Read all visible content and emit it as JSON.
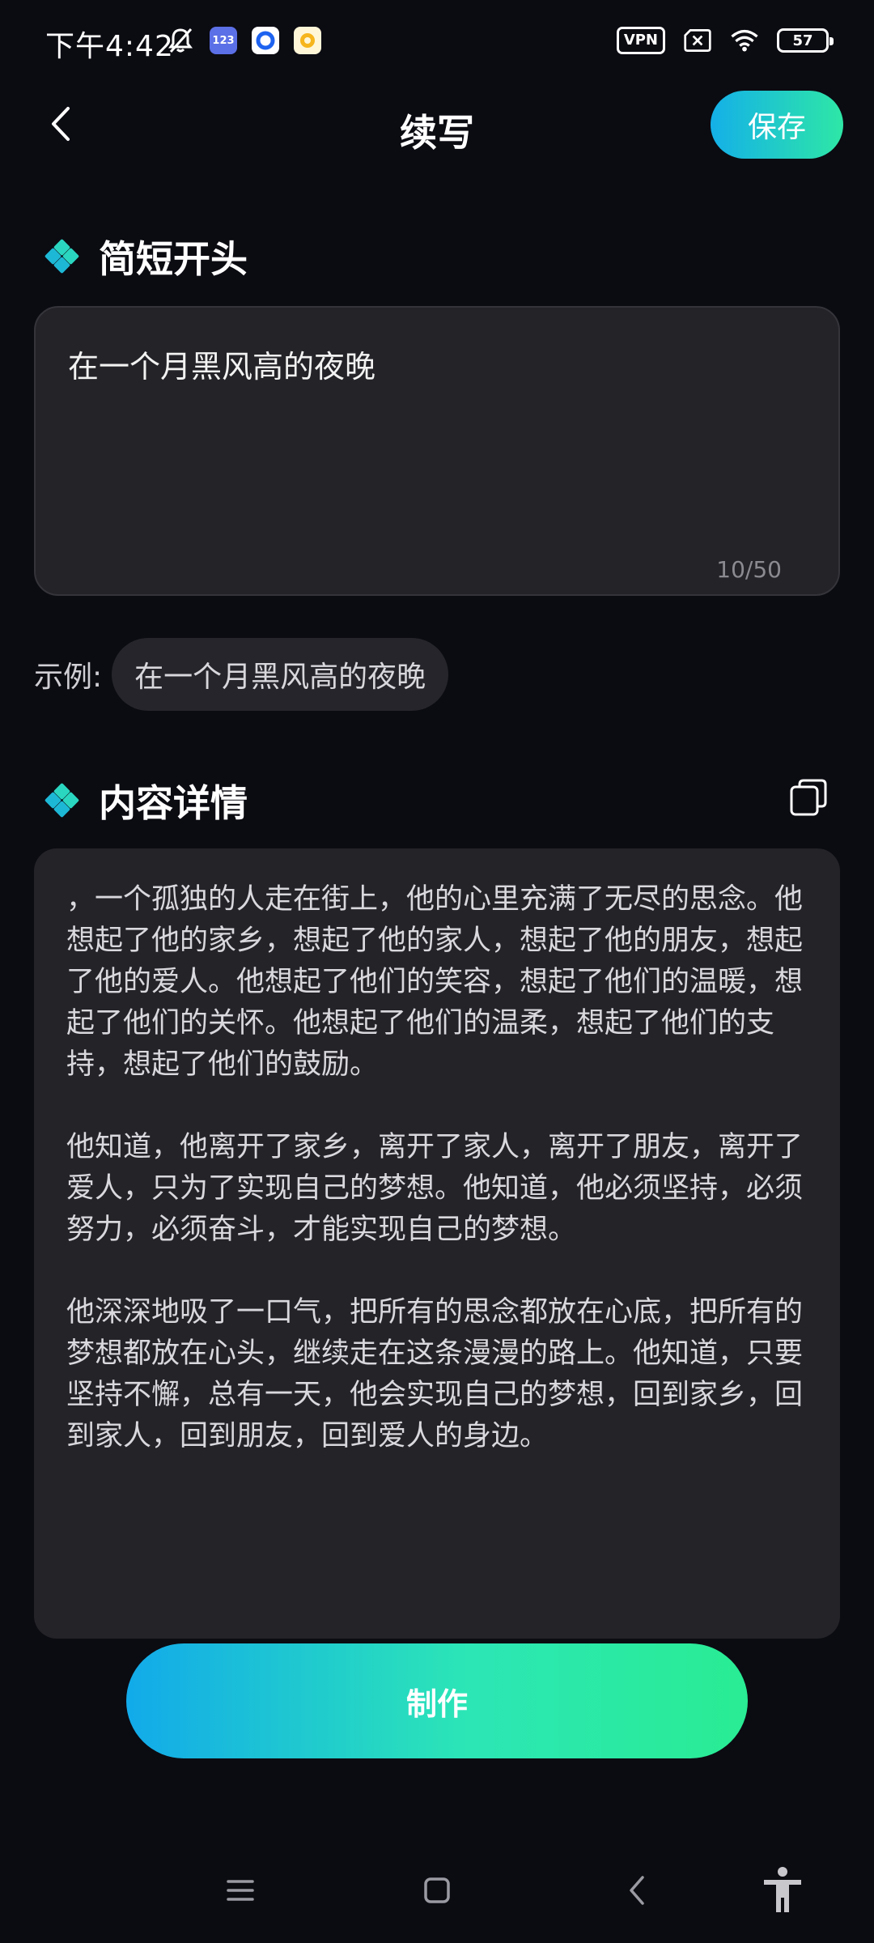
{
  "status_bar": {
    "time": "下午4:42",
    "app_badge_1": "123",
    "vpn_label": "VPN",
    "battery_level": "57"
  },
  "header": {
    "title": "续写",
    "save_label": "保存"
  },
  "opening_section": {
    "heading": "简短开头",
    "input_value": "在一个月黑风高的夜晚",
    "char_count": "10/50"
  },
  "example": {
    "label": "示例:",
    "chip_text": "在一个月黑风高的夜晚"
  },
  "content_section": {
    "heading": "内容详情",
    "paragraphs": [
      "，一个孤独的人走在街上，他的心里充满了无尽的思念。他想起了他的家乡，想起了他的家人，想起了他的朋友，想起了他的爱人。他想起了他们的笑容，想起了他们的温暖，想起了他们的关怀。他想起了他们的温柔，想起了他们的支持，想起了他们的鼓励。",
      "他知道，他离开了家乡，离开了家人，离开了朋友，离开了爱人，只为了实现自己的梦想。他知道，他必须坚持，必须努力，必须奋斗，才能实现自己的梦想。",
      "他深深地吸了一口气，把所有的思念都放在心底，把所有的梦想都放在心头，继续走在这条漫漫的路上。他知道，只要坚持不懈，总有一天，他会实现自己的梦想，回到家乡，回到家人，回到朋友，回到爱人的身边。"
    ]
  },
  "action": {
    "make_label": "制作"
  },
  "colors": {
    "background": "#0b0b12",
    "card": "#232328",
    "accent_start": "#12aaea",
    "accent_end": "#29ec93",
    "diamond_teal": "#2ad6c0"
  },
  "icons": {
    "back": "chevron-left-icon",
    "section_marker": "diamond-cluster-icon",
    "copy": "copy-icon",
    "nav_menu": "menu-icon",
    "nav_home": "home-square-icon",
    "nav_back": "back-chevron-icon",
    "accessibility": "accessibility-icon"
  }
}
